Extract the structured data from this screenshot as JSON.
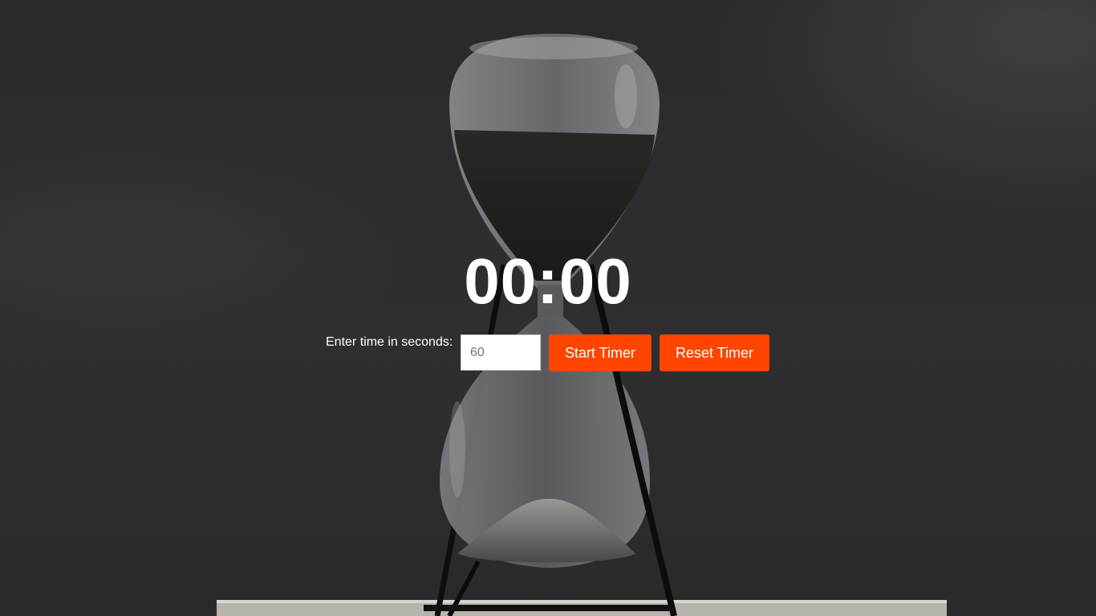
{
  "timer": {
    "display": "00:00"
  },
  "controls": {
    "label": "Enter time in seconds:",
    "input_placeholder": "60",
    "input_value": "",
    "start_label": "Start Timer",
    "reset_label": "Reset Timer"
  },
  "colors": {
    "accent": "#ff4500",
    "text": "#ffffff",
    "background": "#2b2b2d"
  },
  "icons": {
    "background_image": "hourglass-image"
  }
}
